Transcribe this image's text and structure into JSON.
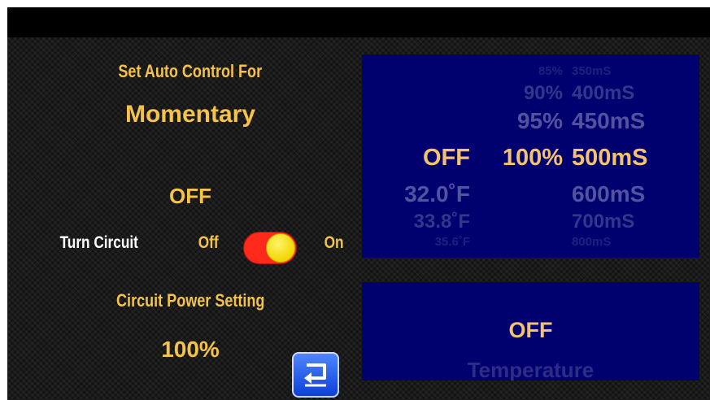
{
  "left_panel": {
    "heading": "Set Auto Control For",
    "mode": "Momentary",
    "state": "OFF",
    "turn_circuit_label": "Turn Circuit",
    "toggle_off_label": "Off",
    "toggle_on_label": "On",
    "toggle_state": "on",
    "power_title": "Circuit Power Setting",
    "power_value": "100%"
  },
  "picker": {
    "column1": {
      "above": [],
      "selected": "OFF",
      "below": [
        "32.0˚F",
        "33.8˚F",
        "35.6˚F"
      ]
    },
    "column2": {
      "above": [
        "85%",
        "90%",
        "95%"
      ],
      "selected": "100%",
      "below": []
    },
    "column3": {
      "above": [
        "350mS",
        "400mS",
        "450mS"
      ],
      "selected": "500mS",
      "below": [
        "600mS",
        "700mS",
        "800mS"
      ]
    }
  },
  "status_panel": {
    "value": "OFF",
    "label": "Temperature"
  },
  "icons": {
    "return": "return-arrow-icon"
  },
  "colors": {
    "accent": "#f5c24a",
    "panel": "#00006e",
    "toggle_track": "#ff2a1a",
    "toggle_knob": "#f2d600"
  }
}
